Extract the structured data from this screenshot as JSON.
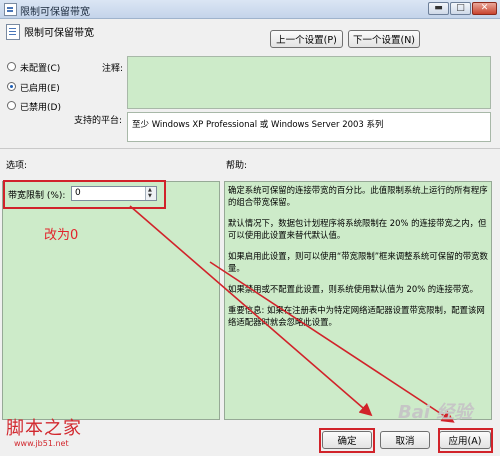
{
  "window": {
    "title": "限制可保留带宽",
    "minimize_glyph": "▬",
    "maximize_glyph": "□",
    "close_glyph": "✕"
  },
  "header": {
    "policy_name": "限制可保留带宽",
    "prev_button": "上一个设置(P)",
    "next_button": "下一个设置(N)"
  },
  "state": {
    "options": [
      {
        "label": "未配置(C)",
        "checked": false
      },
      {
        "label": "已启用(E)",
        "checked": true
      },
      {
        "label": "已禁用(D)",
        "checked": false
      }
    ]
  },
  "comment": {
    "label": "注释:"
  },
  "platform": {
    "label": "支持的平台:",
    "value": "至少 Windows XP Professional 或 Windows Server 2003 系列"
  },
  "options_section": {
    "label": "选项:",
    "field_label": "带宽限制 (%):",
    "field_value": "0"
  },
  "help_section": {
    "label": "帮助:",
    "paragraphs": [
      "确定系统可保留的连接带宽的百分比。此值限制系统上运行的所有程序的组合带宽保留。",
      "默认情况下，数据包计划程序将系统限制在 20% 的连接带宽之内，但可以使用此设置来替代默认值。",
      "如果启用此设置，则可以使用“带宽限制”框来调整系统可保留的带宽数量。",
      "如果禁用或不配置此设置，则系统使用默认值为 20% 的连接带宽。",
      "重要信息: 如果在注册表中为特定网络适配器设置带宽限制，配置该网络适配器时就会忽略此设置。"
    ]
  },
  "footer": {
    "ok_button": "确定",
    "cancel_button": "取消",
    "apply_button": "应用(A)"
  },
  "annotation": {
    "text": "改为0",
    "color": "#e2242c"
  },
  "watermark": {
    "site_name": "脚本之家",
    "site_url": "www.jb51.net",
    "baidu_text": "Bai 经验"
  }
}
